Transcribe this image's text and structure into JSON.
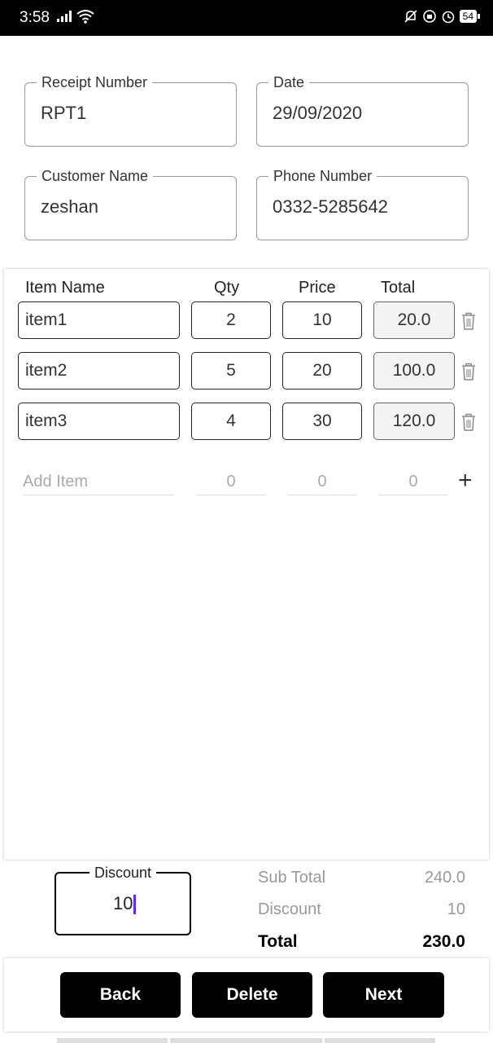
{
  "status": {
    "time": "3:58",
    "battery": "54"
  },
  "form": {
    "receipt_number_label": "Receipt Number",
    "receipt_number": "RPT1",
    "date_label": "Date",
    "date": "29/09/2020",
    "customer_name_label": "Customer Name",
    "customer_name": "zeshan",
    "phone_number_label": "Phone Number",
    "phone_number": "0332-5285642"
  },
  "table": {
    "headers": {
      "name": "Item Name",
      "qty": "Qty",
      "price": "Price",
      "total": "Total"
    },
    "rows": [
      {
        "name": "item1",
        "qty": "2",
        "price": "10",
        "total": "20.0"
      },
      {
        "name": "item2",
        "qty": "5",
        "price": "20",
        "total": "100.0"
      },
      {
        "name": "item3",
        "qty": "4",
        "price": "30",
        "total": "120.0"
      }
    ],
    "add_row": {
      "name_placeholder": "Add Item",
      "qty_placeholder": "0",
      "price_placeholder": "0",
      "total_placeholder": "0"
    }
  },
  "summary": {
    "discount_input_label": "Discount",
    "discount_input_value": "10",
    "subtotal_label": "Sub Total",
    "subtotal_value": "240.0",
    "discount_label": "Discount",
    "discount_value": "10",
    "total_label": "Total",
    "total_value": "230.0"
  },
  "buttons": {
    "back": "Back",
    "delete": "Delete",
    "next": "Next"
  },
  "colors": {
    "caret": "#6a2bd9",
    "button_bg": "#000000"
  }
}
